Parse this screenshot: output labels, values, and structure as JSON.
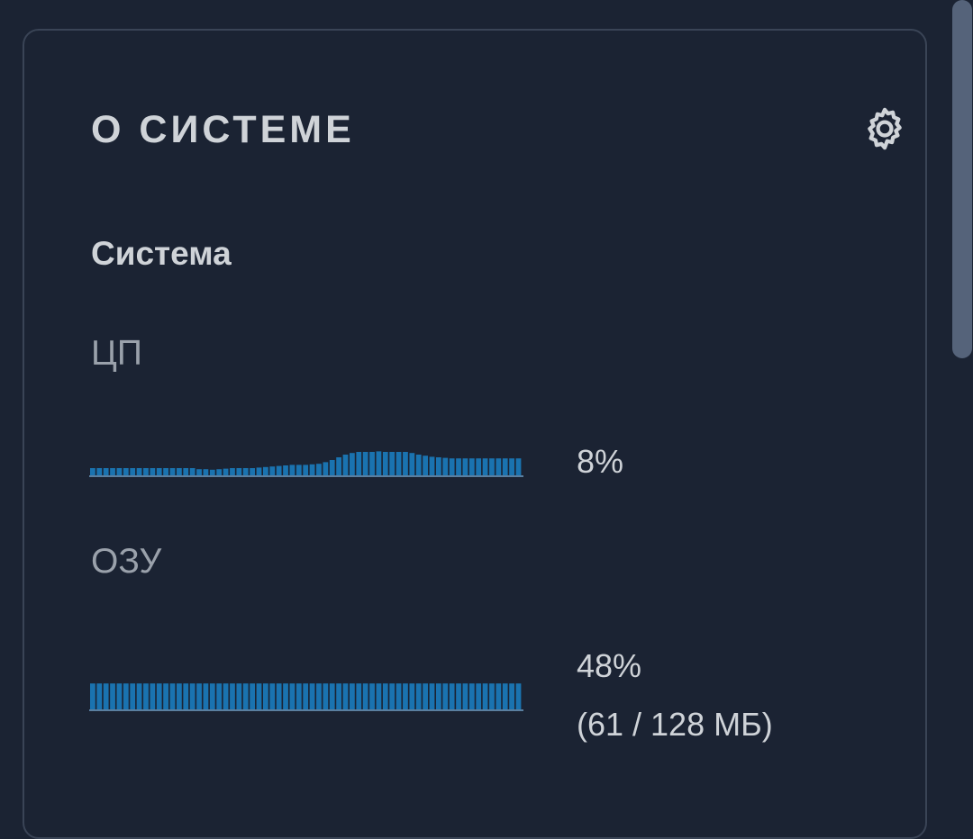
{
  "card": {
    "title": "О СИСТЕМЕ",
    "settings_icon": "gear-icon",
    "section_title": "Система"
  },
  "cpu": {
    "label": "ЦП",
    "value": "8%",
    "history": [
      0.3,
      0.3,
      0.3,
      0.3,
      0.3,
      0.3,
      0.3,
      0.3,
      0.3,
      0.3,
      0.3,
      0.3,
      0.3,
      0.3,
      0.3,
      0.3,
      0.26,
      0.26,
      0.24,
      0.26,
      0.28,
      0.3,
      0.3,
      0.3,
      0.3,
      0.32,
      0.34,
      0.36,
      0.38,
      0.4,
      0.42,
      0.42,
      0.42,
      0.44,
      0.46,
      0.52,
      0.6,
      0.7,
      0.8,
      0.86,
      0.9,
      0.9,
      0.9,
      0.92,
      0.9,
      0.9,
      0.9,
      0.9,
      0.86,
      0.8,
      0.76,
      0.72,
      0.7,
      0.68,
      0.66,
      0.66,
      0.66,
      0.66,
      0.66,
      0.66,
      0.66,
      0.66,
      0.66,
      0.66,
      0.66
    ]
  },
  "ram": {
    "label": "ОЗУ",
    "value": "48%",
    "detail": "(61 / 128 МБ)",
    "history": [
      0.48,
      0.48,
      0.48,
      0.48,
      0.48,
      0.48,
      0.48,
      0.48,
      0.48,
      0.48,
      0.48,
      0.48,
      0.48,
      0.48,
      0.48,
      0.48,
      0.48,
      0.48,
      0.48,
      0.48,
      0.48,
      0.48,
      0.48,
      0.48,
      0.48,
      0.48,
      0.48,
      0.48,
      0.48,
      0.48,
      0.48,
      0.48,
      0.48,
      0.48,
      0.48,
      0.48,
      0.48,
      0.48,
      0.48,
      0.48,
      0.48,
      0.48,
      0.48,
      0.48,
      0.48,
      0.48,
      0.48,
      0.48,
      0.48,
      0.48,
      0.48,
      0.48,
      0.48,
      0.48,
      0.48,
      0.48,
      0.48,
      0.48,
      0.48,
      0.48,
      0.48,
      0.48,
      0.48,
      0.48,
      0.48
    ]
  },
  "colors": {
    "bar": "#1a73b0",
    "baseline": "#5a7fa0"
  }
}
